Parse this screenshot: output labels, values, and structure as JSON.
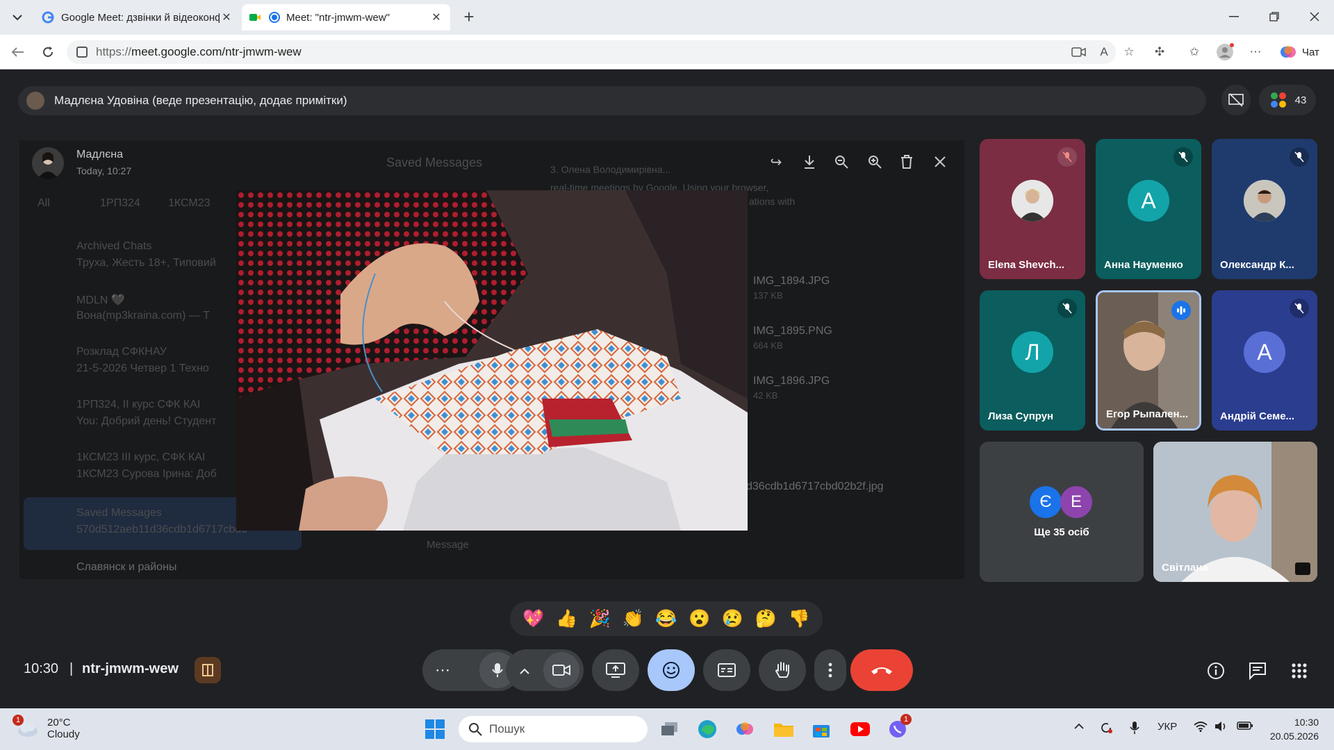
{
  "browser": {
    "tabs": [
      {
        "title": "Google Meet: дзвінки й відеоконф",
        "close": "✕"
      },
      {
        "title": "Meet: \"ntr-jmwm-wew\"",
        "close": "✕"
      }
    ],
    "new_tab": "+",
    "url_proto": "https://",
    "url_host": "meet.google.com/ntr-jmwm-wew",
    "copilot_label": "Чат"
  },
  "meet": {
    "presenter_text": "Мадлєна Удовіна (веде презентацію, додає примітки)",
    "participants_count": "43",
    "viewer": {
      "name": "Мадлєна",
      "time": "Today, 10:27"
    },
    "background_text": {
      "saved_messages": "Saved Messages",
      "tab_all": "All",
      "tab_1": "1РП324",
      "tab_2": "1КСМ23",
      "archived": "Archived Chats",
      "archived_sub": "Труха, Жесть 18+, Типовий",
      "mdln": "MDLN 🖤",
      "mdln_sub": "Вона(mp3kraina.com) — Т",
      "rozklad": "Розклад СФКНАУ",
      "rozklad_sub": "21-5-2026 Четвер 1 Техно",
      "g1": "1РП324, ІІ курс СФК КАІ",
      "g1_sub": "You: Добрий день! Студент",
      "g2": "1КСМ23 ІІІ курс, СФК КАІ",
      "g2_sub": "1КСМ23 Сурова Ірина: Доб",
      "saved_chat": "Saved Messages",
      "saved_chat_sub": "570d512aeb11d36cdb1d6717cbd0",
      "slav": "Славянск и районы",
      "msg_line1": "real-time meetings by Google. Using your browser,",
      "msg_line2": "ations with",
      "olena": "3. Олена Володимирівна...",
      "f1": "IMG_1894.JPG",
      "f1s": "137 KB",
      "f2": "IMG_1895.PNG",
      "f2s": "664 KB",
      "f3": "IMG_1896.JPG",
      "f3s": "42 KB",
      "jpg": "d36cdb1d6717cbd02b2f.jpg",
      "message_ph": "Message"
    },
    "tiles": [
      {
        "name": "Elena Shevch...",
        "color": "#7b2d43"
      },
      {
        "name": "Анна Науменко",
        "letter": "А",
        "color": "#0b5d5e",
        "letter_bg": "#12a4a8"
      },
      {
        "name": "Олександр К...",
        "color": "#1f3b6e"
      },
      {
        "name": "Лиза Супрун",
        "letter": "Л",
        "color": "#0b5d5e",
        "letter_bg": "#12a4a8"
      },
      {
        "name": "Егор Рыпален...",
        "color": "#5a5048"
      },
      {
        "name": "Андрій Семе...",
        "letter": "А",
        "color": "#2b3d8f",
        "letter_bg": "#5a6fd6"
      },
      {
        "name": "Світлана",
        "color": "#a9b4bf"
      }
    ],
    "more": {
      "label": "Ще 35 осіб",
      "a1": "Є",
      "a2": "Е"
    },
    "reactions": [
      "💖",
      "👍",
      "🎉",
      "👏",
      "😂",
      "😮",
      "😢",
      "🤔",
      "👎"
    ],
    "time": "10:30",
    "separator": "|",
    "code": "ntr-jmwm-wew"
  },
  "taskbar": {
    "weather_temp": "20°C",
    "weather_cond": "Cloudy",
    "weather_badge": "1",
    "search_placeholder": "Пошук",
    "lang": "УКР",
    "time": "10:30",
    "date": "20.05.2026",
    "viber_badge": "1"
  }
}
